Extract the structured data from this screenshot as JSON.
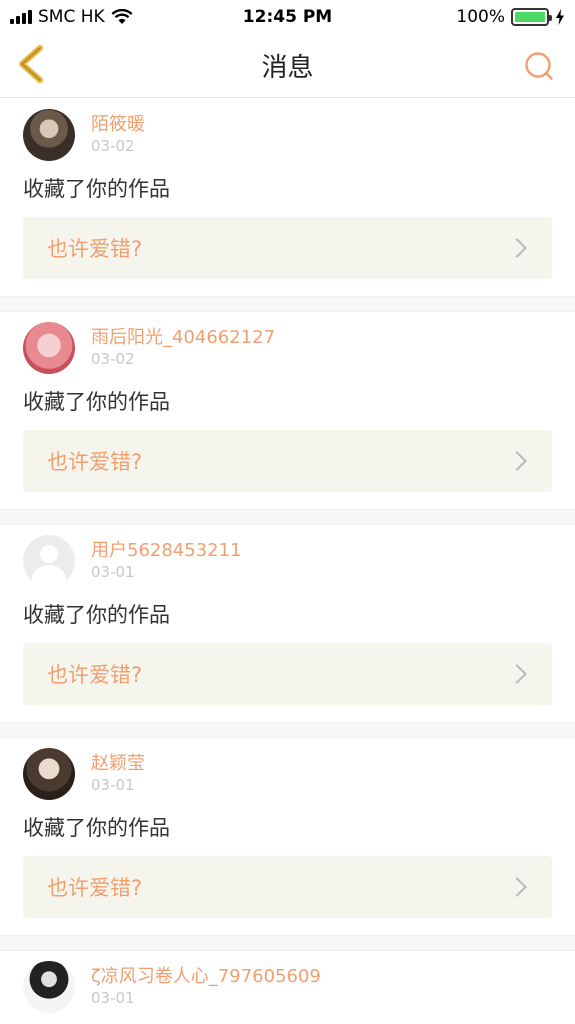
{
  "status_bar": {
    "carrier": "SMC HK",
    "time": "12:45 PM",
    "battery": "100%",
    "battery_level": 1.0
  },
  "nav": {
    "title": "消息",
    "back_icon": "chevron-left-icon",
    "search_icon": "search-icon"
  },
  "colors": {
    "accent": "#f0a070",
    "back_icon": "#e8b43a",
    "box_bg": "#f5f5ee"
  },
  "messages": [
    {
      "user": "陌筱暖",
      "date": "03-02",
      "action": "收藏了你的作品",
      "work": "也许爱错?"
    },
    {
      "user": "雨后阳光_404662127",
      "date": "03-02",
      "action": "收藏了你的作品",
      "work": "也许爱错?"
    },
    {
      "user": "用户5628453211",
      "date": "03-01",
      "action": "收藏了你的作品",
      "work": "也许爱错?"
    },
    {
      "user": "赵颖莹",
      "date": "03-01",
      "action": "收藏了你的作品",
      "work": "也许爱错?"
    },
    {
      "user": "ζ凉风习卷人心_797605609",
      "date": "03-01"
    }
  ]
}
